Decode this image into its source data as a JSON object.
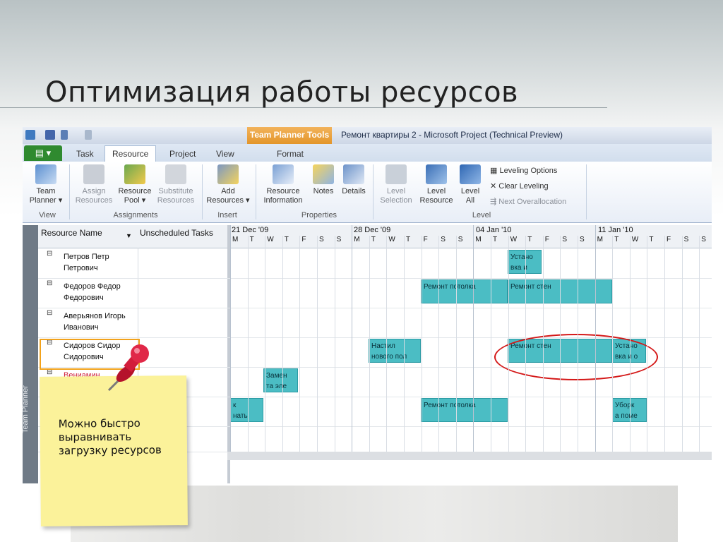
{
  "slide": {
    "title": "Оптимизация работы ресурсов",
    "note": "Можно быстро выравнивать загрузку ресурсов"
  },
  "window": {
    "context_tab": "Team Planner Tools",
    "title": "Ремонт квартиры 2  -  Microsoft Project (Technical Preview)"
  },
  "ribbon": {
    "tabs": [
      "Task",
      "Resource",
      "Project",
      "View",
      "Format"
    ],
    "active_tab": "Resource",
    "buttons": {
      "team_planner": "Team\nPlanner ▾",
      "assign_resources": "Assign\nResources",
      "resource_pool": "Resource\nPool ▾",
      "substitute_resources": "Substitute\nResources",
      "add_resources": "Add\nResources ▾",
      "resource_information": "Resource\nInformation",
      "notes": "Notes",
      "details": "Details",
      "level_selection": "Level\nSelection",
      "level_resource": "Level\nResource",
      "level_all": "Level\nAll",
      "leveling_options": "Leveling Options",
      "clear_leveling": "Clear Leveling",
      "next_overallocation": "Next Overallocation"
    },
    "groups": [
      "View",
      "Assignments",
      "Insert",
      "Properties",
      "Level"
    ]
  },
  "grid": {
    "side_tab": "Team Planner",
    "columns": [
      "Resource Name",
      "Unscheduled Tasks"
    ],
    "weeks": [
      "21 Dec '09",
      "28 Dec '09",
      "04 Jan '10",
      "11 Jan '10"
    ],
    "days": [
      "M",
      "T",
      "W",
      "T",
      "F",
      "S",
      "S",
      "M",
      "T",
      "W",
      "T",
      "F",
      "S",
      "S",
      "M",
      "T",
      "W",
      "T",
      "F",
      "S",
      "S",
      "M",
      "T",
      "W",
      "T",
      "F",
      "S",
      "S"
    ],
    "rows": [
      {
        "name": "Петров Петр\nПетрович"
      },
      {
        "name": "Федоров Федор\nФедорович"
      },
      {
        "name": "Аверьянов Игорь\nИванович"
      },
      {
        "name": "Сидоров Сидор\nСидорович"
      },
      {
        "name": "Вениамин"
      },
      {
        "name": ""
      },
      {
        "name": ""
      }
    ],
    "bars": [
      {
        "label": "Устано\nвка и"
      },
      {
        "label": "Ремонт потолка"
      },
      {
        "label": "Ремонт стен"
      },
      {
        "label": "Настил\nнового пол"
      },
      {
        "label": "Ремонт стен"
      },
      {
        "label": "Устано\nвка и о"
      },
      {
        "label": "Замен\nта эле"
      },
      {
        "label": "к\nнаты"
      },
      {
        "label": "Ремонт потолка"
      },
      {
        "label": "Уборк\nа поме"
      }
    ]
  }
}
